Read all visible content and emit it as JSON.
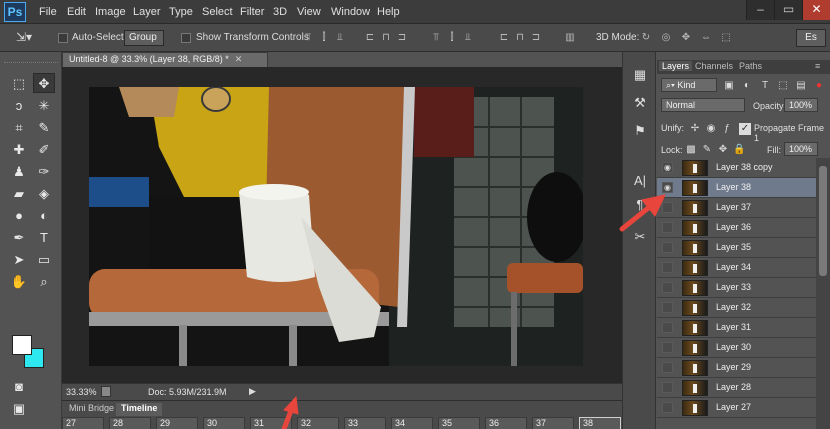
{
  "menubar": {
    "logo": "Ps",
    "items": [
      "File",
      "Edit",
      "Image",
      "Layer",
      "Type",
      "Select",
      "Filter",
      "3D",
      "View",
      "Window",
      "Help"
    ]
  },
  "options": {
    "auto_select_label": "Auto-Select:",
    "auto_select_value": "Group",
    "show_transform_label": "Show Transform Controls",
    "mode_3d_label": "3D Mode:",
    "workspace_label": "Es"
  },
  "document": {
    "tab_title": "Untitled-8 @ 33.3% (Layer 38, RGB/8) *",
    "zoom": "33.33%",
    "doc_size": "Doc: 5.93M/231.9M"
  },
  "timeline": {
    "tabs": [
      "Mini Bridge",
      "Timeline"
    ],
    "frames": [
      "27",
      "28",
      "29",
      "30",
      "31",
      "32",
      "33",
      "34",
      "35",
      "36",
      "37",
      "38"
    ]
  },
  "layers_panel": {
    "tabs": [
      "Layers",
      "Channels",
      "Paths"
    ],
    "filter_label": "Kind",
    "blend_mode": "Normal",
    "opacity_label": "Opacity:",
    "opacity_value": "100%",
    "unify_label": "Unify:",
    "propagate_label": "Propagate Frame 1",
    "lock_label": "Lock:",
    "fill_label": "Fill:",
    "fill_value": "100%",
    "layers": [
      {
        "name": "Layer 38 copy",
        "visible": true
      },
      {
        "name": "Layer 38",
        "visible": true,
        "selected": true
      },
      {
        "name": "Layer 37",
        "visible": false
      },
      {
        "name": "Layer 36",
        "visible": false
      },
      {
        "name": "Layer 35",
        "visible": false
      },
      {
        "name": "Layer 34",
        "visible": false
      },
      {
        "name": "Layer 33",
        "visible": false
      },
      {
        "name": "Layer 32",
        "visible": false
      },
      {
        "name": "Layer 31",
        "visible": false
      },
      {
        "name": "Layer 30",
        "visible": false
      },
      {
        "name": "Layer 29",
        "visible": false
      },
      {
        "name": "Layer 28",
        "visible": false
      },
      {
        "name": "Layer 27",
        "visible": false
      }
    ]
  },
  "colors": {
    "foreground": "#ffffff",
    "background": "#2de8ee",
    "annotation_arrow": "#e8453c"
  }
}
